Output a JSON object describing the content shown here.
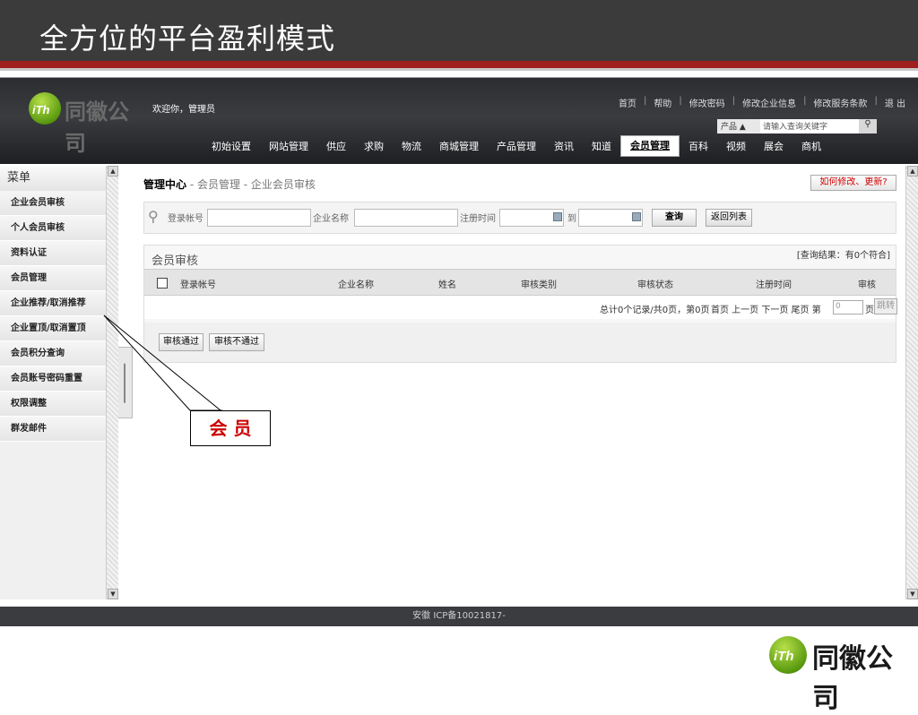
{
  "slide": {
    "title": "全方位的平台盈利模式",
    "callout_label": "会 员",
    "corner_logo": {
      "mark": "iTh",
      "name": "同徽公司"
    }
  },
  "header": {
    "logo_mark": "iTh",
    "logo_name": "同徽公司",
    "welcome": "欢迎你，管理员",
    "top_links": [
      "首页",
      "帮助",
      "修改密码",
      "修改企业信息",
      "修改服务条款",
      "退 出"
    ],
    "search": {
      "category": "产品 ▲",
      "placeholder": "请输入查询关键字",
      "button_icon": "search-icon"
    },
    "nav": [
      "初始设置",
      "网站管理",
      "供应",
      "求购",
      "物流",
      "商城管理",
      "产品管理",
      "资讯",
      "知道",
      "会员管理",
      "百科",
      "视频",
      "展会",
      "商机"
    ],
    "active_nav": "会员管理"
  },
  "sidebar": {
    "title": "菜单",
    "items": [
      "企业会员审核",
      "个人会员审核",
      "资料认证",
      "会员管理",
      "企业推荐/取消推荐",
      "企业置顶/取消置顶",
      "会员积分查询",
      "会员账号密码重置",
      "权限调整",
      "群发邮件"
    ]
  },
  "content": {
    "breadcrumb_root": "管理中心",
    "breadcrumb_rest": " - 会员管理 - 企业会员审核",
    "help_button": "如何修改、更新?",
    "filter": {
      "login_label": "登录帐号",
      "company_label": "企业名称",
      "reg_time_label": "注册时间",
      "to_label": "到",
      "query_button": "查询",
      "back_button": "返回列表"
    },
    "grid": {
      "title": "会员审核",
      "result": "[查询结果：有0个符合]",
      "columns": [
        "登录帐号",
        "企业名称",
        "姓名",
        "审核类别",
        "审核状态",
        "注册时间",
        "审核"
      ],
      "pager_summary": "总计0个记录/共0页，第0页",
      "pager_links": "首页 上一页  下一页  尾页 第",
      "page_suffix": "页",
      "jump_button": "跳转",
      "page_value": "0"
    },
    "actions": {
      "approve": "审核通过",
      "reject": "审核不通过"
    }
  },
  "footer": {
    "text": "安徽 ICP备10021817-"
  }
}
